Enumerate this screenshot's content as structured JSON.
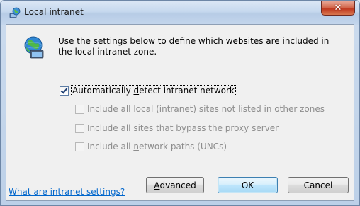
{
  "window": {
    "title": "Local intranet"
  },
  "icons": {
    "title": "intranet-globe-icon",
    "main": "globe-computer-icon",
    "close": "close-icon"
  },
  "intro": {
    "line1": "Use the settings below to define which websites are included in",
    "line2": "the local intranet zone."
  },
  "options": {
    "auto_detect": {
      "label_pre": "Automatically ",
      "label_key": "d",
      "label_post": "etect intranet network",
      "checked": true,
      "enabled": true
    },
    "include_local": {
      "label_pre": "Include all local (intranet) sites not listed in other ",
      "label_key": "z",
      "label_post": "ones",
      "checked": false,
      "enabled": false
    },
    "include_bypass": {
      "label_pre": "Include all sites that bypass the ",
      "label_key": "p",
      "label_post": "roxy server",
      "checked": false,
      "enabled": false
    },
    "include_network": {
      "label_pre": "Include all ",
      "label_key": "n",
      "label_post": "etwork paths (UNCs)",
      "checked": false,
      "enabled": false
    }
  },
  "footer": {
    "help_link": "What are intranet settings?",
    "advanced_key": "A",
    "advanced_rest": "dvanced",
    "ok_label": "OK",
    "cancel_label": "Cancel"
  },
  "colors": {
    "link": "#0066cc",
    "disabled_text": "#8d8d8d",
    "close_button": "#c0391f"
  }
}
